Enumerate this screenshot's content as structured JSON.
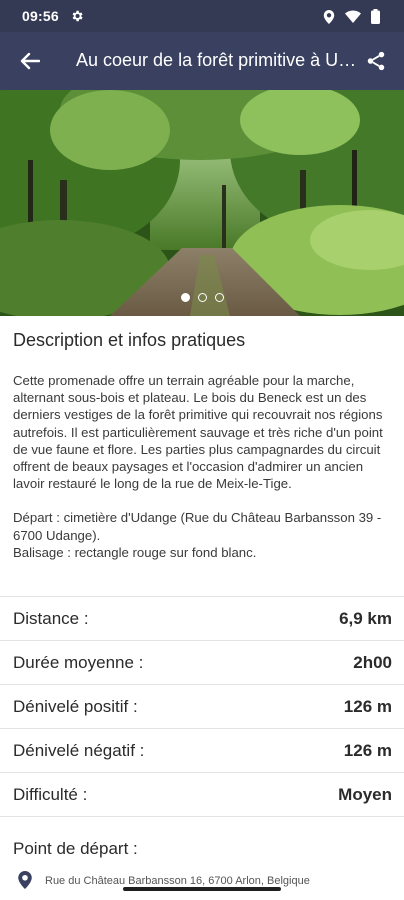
{
  "status": {
    "time": "09:56"
  },
  "appbar": {
    "title": "Au coeur de la forêt primitive à Udange",
    "back_icon": "arrow-left-icon",
    "share_icon": "share-icon"
  },
  "carousel": {
    "page_count": 3,
    "current_page": 1
  },
  "description": {
    "title": "Description et infos pratiques",
    "paragraph1": "Cette promenade offre un terrain agréable pour la marche, alternant sous-bois et plateau. Le bois du Beneck est un des derniers vestiges de la forêt primitive qui recouvrait nos régions autrefois. Il est particulièrement sauvage et très riche d'un point de vue faune et flore. Les parties plus campagnardes du circuit offrent de beaux paysages et l'occasion d'admirer un ancien lavoir restauré le long de la rue de Meix-le-Tige.",
    "paragraph2_line1": "Départ : cimetière d'Udange (Rue du Château Barbansson 39 - 6700 Udange).",
    "paragraph2_line2": "Balisage : rectangle rouge sur fond blanc."
  },
  "stats": [
    {
      "label": "Distance :",
      "value": "6,9 km"
    },
    {
      "label": "Durée moyenne :",
      "value": "2h00"
    },
    {
      "label": "Dénivelé positif :",
      "value": "126 m"
    },
    {
      "label": "Dénivelé négatif :",
      "value": "126 m"
    },
    {
      "label": "Difficulté :",
      "value": "Moyen"
    }
  ],
  "start_point": {
    "title": "Point de départ :",
    "address": "Rue du Château Barbansson 16, 6700 Arlon, Belgique"
  }
}
